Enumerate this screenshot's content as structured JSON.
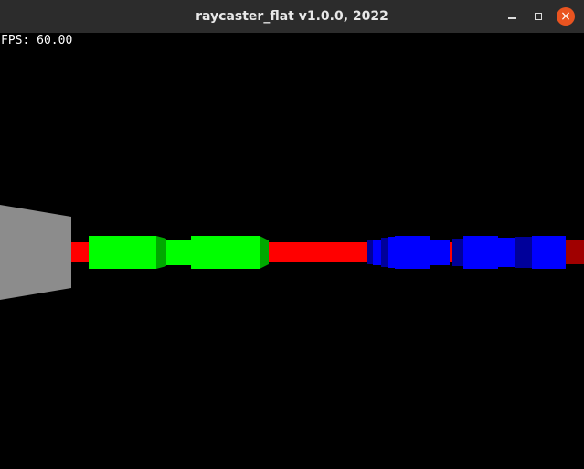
{
  "window": {
    "title": "raycaster_flat v1.0.0, 2022",
    "buttons": {
      "minimize": "minimize",
      "maximize": "maximize",
      "close": "close"
    }
  },
  "hud": {
    "fps_text": "FPS: 60.00"
  },
  "colors": {
    "background": "#000000",
    "titlebar": "#2c2c2c",
    "wall_red": "#ff0000",
    "wall_green": "#00ff00",
    "wall_blue": "#0000ff",
    "wall_gray": "#8c8c8c",
    "close_button": "#e95420"
  }
}
